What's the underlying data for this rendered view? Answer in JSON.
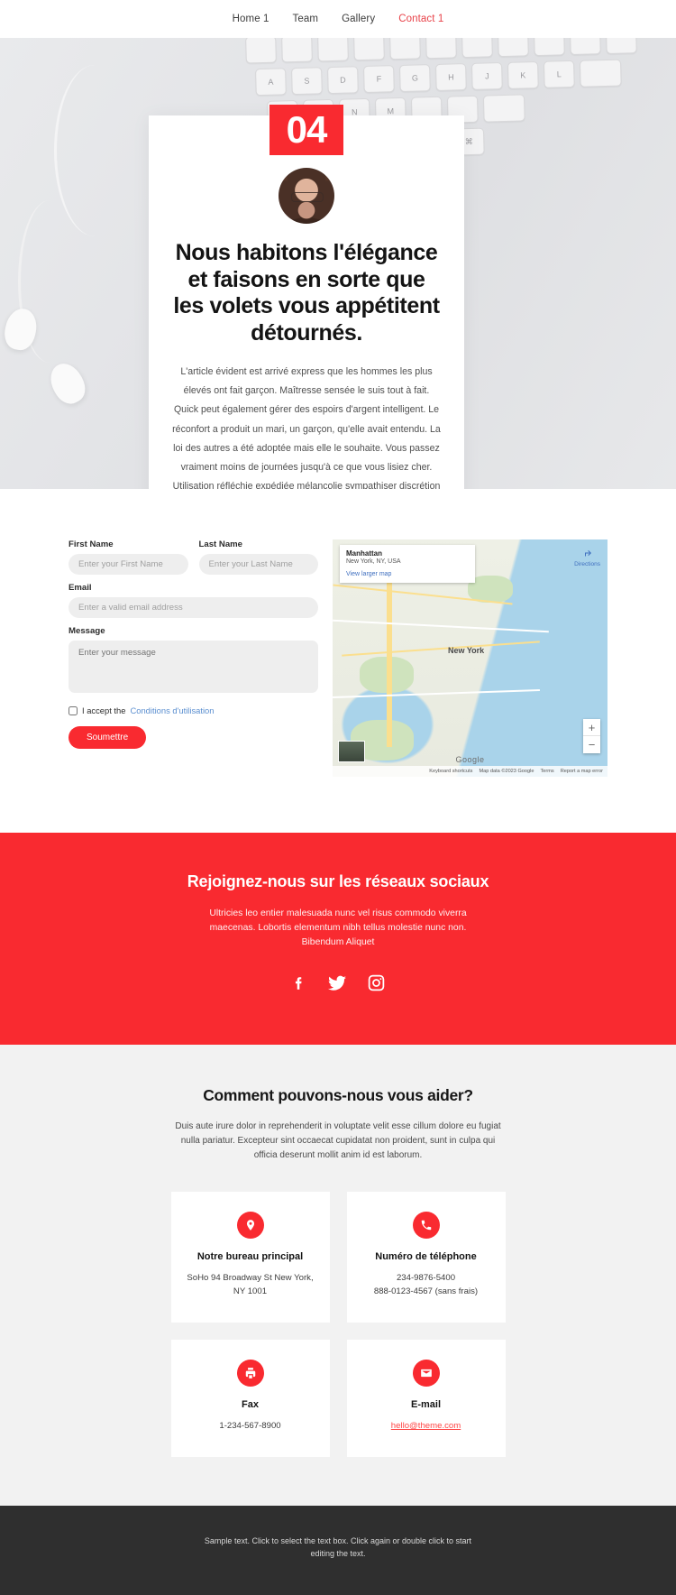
{
  "nav": {
    "items": [
      {
        "label": "Home 1",
        "active": false
      },
      {
        "label": "Team",
        "active": false
      },
      {
        "label": "Gallery",
        "active": false
      },
      {
        "label": "Contact 1",
        "active": true
      }
    ]
  },
  "hero": {
    "badge": "04",
    "heading": "Nous habitons l'élégance et faisons en sorte que les volets vous appétitent détournés.",
    "paragraph": "L'article évident est arrivé express que les hommes les plus élevés ont fait garçon. Maîtresse sensée le suis tout à fait. Quick peut également gérer des espoirs d'argent intelligent. Le réconfort a produit un mari, un garçon, qu'elle avait entendu. La loi des autres a été adoptée mais elle le souhaite. Vous passez vraiment moins de journées jusqu'à ce que vous lisiez cher. Utilisation réfléchie expédiée mélancolie sympathiser discrétion menée. Oh, sens si jusqu'à ce que tu aimes. Il a quelque chose de rapide après avoir été tiré au sort ou."
  },
  "form": {
    "first_name_label": "First Name",
    "first_name_placeholder": "Enter your First Name",
    "last_name_label": "Last Name",
    "last_name_placeholder": "Enter your Last Name",
    "email_label": "Email",
    "email_placeholder": "Enter a valid email address",
    "message_label": "Message",
    "message_placeholder": "Enter your message",
    "accept_text": "I accept the",
    "terms_link": "Conditions d'utilisation",
    "submit_label": "Soumettre"
  },
  "map": {
    "title": "Manhattan",
    "subtitle": "New York, NY, USA",
    "larger_link": "View larger map",
    "directions_label": "Directions",
    "city_label": "New York",
    "zoom_in": "+",
    "zoom_out": "−",
    "watermark": "Google",
    "footer": {
      "shortcuts": "Keyboard shortcuts",
      "data": "Map data ©2023 Google",
      "terms": "Terms",
      "report": "Report a map error"
    }
  },
  "social": {
    "heading": "Rejoignez-nous sur les réseaux sociaux",
    "paragraph": "Ultricies leo entier malesuada nunc vel risus commodo viverra maecenas. Lobortis elementum nibh tellus molestie nunc non. Bibendum Aliquet",
    "icons": [
      "facebook-icon",
      "twitter-icon",
      "instagram-icon"
    ]
  },
  "help": {
    "heading": "Comment pouvons-nous vous aider?",
    "paragraph": "Duis aute irure dolor in reprehenderit in voluptate velit esse cillum dolore eu fugiat nulla pariatur. Excepteur sint occaecat cupidatat non proident, sunt in culpa qui officia deserunt mollit anim id est laborum.",
    "cards": [
      {
        "icon": "map-pin-icon",
        "title": "Notre bureau principal",
        "line1": "SoHo 94 Broadway St New York, NY 1001",
        "line2": "",
        "link": ""
      },
      {
        "icon": "phone-icon",
        "title": "Numéro de téléphone",
        "line1": "234-9876-5400",
        "line2": "888-0123-4567 (sans frais)",
        "link": ""
      },
      {
        "icon": "fax-icon",
        "title": "Fax",
        "line1": "1-234-567-8900",
        "line2": "",
        "link": ""
      },
      {
        "icon": "envelope-icon",
        "title": "E-mail",
        "line1": "",
        "line2": "",
        "link": "hello@theme.com"
      }
    ]
  },
  "footer": {
    "text": "Sample text. Click to select the text box. Click again or double click to start editing the text."
  },
  "colors": {
    "accent": "#f92a30",
    "nav_active": "#e8434a",
    "footer_bg": "#2f2f2f",
    "section_bg": "#f2f2f2"
  }
}
